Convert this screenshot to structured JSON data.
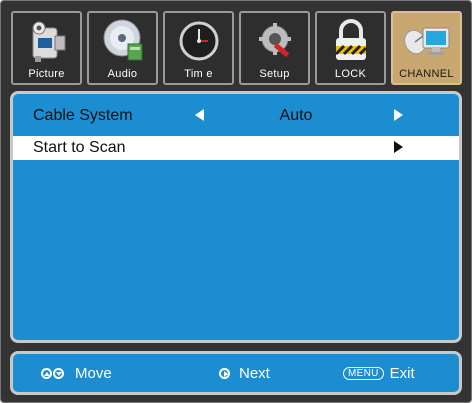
{
  "tabs": [
    {
      "label": "Picture",
      "icon": "camera-icon"
    },
    {
      "label": "Audio",
      "icon": "disc-icon"
    },
    {
      "label": "Tim e",
      "icon": "clock-icon"
    },
    {
      "label": "Setup",
      "icon": "wrench-gear-icon"
    },
    {
      "label": "LOCK",
      "icon": "lock-icon"
    },
    {
      "label": "CHANNEL",
      "icon": "satellite-dish-icon",
      "active": true
    }
  ],
  "menu": {
    "cable_system_label": "Cable System",
    "cable_system_value": "Auto",
    "start_scan_label": "Start  to Scan"
  },
  "footer": {
    "move_label": "Move",
    "next_label": "Next",
    "menu_key": "MENU",
    "exit_label": "Exit"
  },
  "colors": {
    "panel_blue": "#1d8dd2",
    "active_tab": "#c9a770",
    "background": "#333333"
  }
}
